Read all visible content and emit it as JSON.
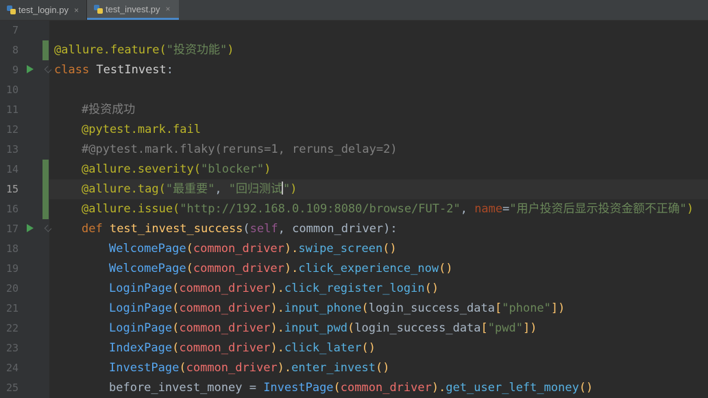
{
  "tabs": [
    {
      "label": "test_login.py",
      "close": "×",
      "active": false
    },
    {
      "label": "test_invest.py",
      "close": "×",
      "active": true
    }
  ],
  "line_numbers": [
    "7",
    "8",
    "9",
    "10",
    "11",
    "12",
    "13",
    "14",
    "15",
    "16",
    "17",
    "18",
    "19",
    "20",
    "21",
    "22",
    "23",
    "24",
    "25"
  ],
  "current_line": "15",
  "code": {
    "l8": [
      "@allure.feature(",
      "\"投资功能\"",
      ")"
    ],
    "l9": [
      "class ",
      "TestInvest",
      ":"
    ],
    "l11": "#投资成功",
    "l12": "@pytest.mark.fail",
    "l13": "#@pytest.mark.flaky(reruns=1, reruns_delay=2)",
    "l14": [
      "@allure.severity(",
      "\"blocker\"",
      ")"
    ],
    "l15": [
      "@allure.tag(",
      "\"最重要\"",
      ", ",
      "\"回归测试",
      "\"",
      ")"
    ],
    "l16": [
      "@allure.issue(",
      "\"http://192.168.0.109:8080/browse/FUT-2\"",
      ", ",
      "name",
      "=",
      "\"用户投资后显示投资金额不正确\"",
      ")"
    ],
    "l17": [
      "def ",
      "test_invest_success",
      "(",
      "self",
      ", ",
      "common_driver",
      "):"
    ],
    "l18": [
      "WelcomePage",
      "(",
      "common_driver",
      ").",
      "swipe_screen",
      "()"
    ],
    "l19": [
      "WelcomePage",
      "(",
      "common_driver",
      ").",
      "click_experience_now",
      "()"
    ],
    "l20": [
      "LoginPage",
      "(",
      "common_driver",
      ").",
      "click_register_login",
      "()"
    ],
    "l21": [
      "LoginPage",
      "(",
      "common_driver",
      ").",
      "input_phone",
      "(",
      "login_success_data",
      "[",
      "\"phone\"",
      "])"
    ],
    "l22": [
      "LoginPage",
      "(",
      "common_driver",
      ").",
      "input_pwd",
      "(",
      "login_success_data",
      "[",
      "\"pwd\"",
      "])"
    ],
    "l23": [
      "IndexPage",
      "(",
      "common_driver",
      ").",
      "click_later",
      "()"
    ],
    "l24": [
      "InvestPage",
      "(",
      "common_driver",
      ").",
      "enter_invest",
      "()"
    ],
    "l25": [
      "before_invest_money",
      " = ",
      "InvestPage",
      "(",
      "common_driver",
      ").",
      "get_user_left_money",
      "()"
    ]
  },
  "colors": {
    "background": "#2b2b2b",
    "gutter": "#313335",
    "decorator": "#bbb529",
    "string": "#6a8759",
    "keyword": "#cc7832",
    "comment": "#808080",
    "class_ref": "#57a8f2",
    "function_def": "#ffc66d",
    "run_icon": "#499c54"
  },
  "icons": {
    "tab_file": "python-file-icon",
    "gutter_run": "run-test-icon",
    "gutter_fold": "fold-icon"
  }
}
